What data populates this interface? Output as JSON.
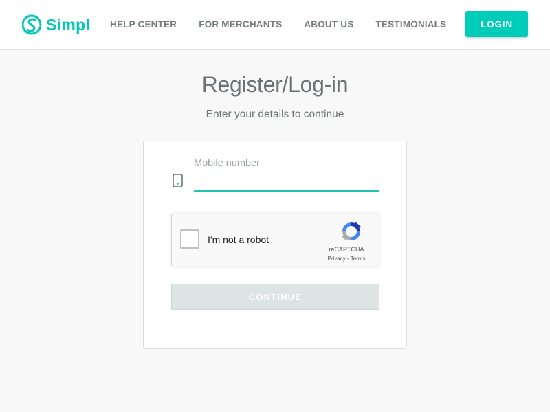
{
  "brand": {
    "name": "Simpl",
    "color": "#00c9b5",
    "icon": "simpl-logo-icon"
  },
  "nav": {
    "items": [
      {
        "label": "HELP CENTER"
      },
      {
        "label": "FOR MERCHANTS"
      },
      {
        "label": "ABOUT US"
      },
      {
        "label": "TESTIMONIALS"
      }
    ],
    "login_label": "LOGIN",
    "login_color": "#00cdb9"
  },
  "main": {
    "title": "Register/Log-in",
    "subtitle": "Enter your details to continue"
  },
  "form": {
    "mobile_icon": "phone-icon",
    "mobile_label": "Mobile number",
    "mobile_value": "",
    "accent_color": "#1fc4b3",
    "continue_label": "CONTINUE",
    "continue_state": "disabled"
  },
  "captcha": {
    "checkbox_label": "I'm not a robot",
    "checked": false,
    "brand": "reCAPTCHA",
    "privacy_label": "Privacy",
    "separator": " - ",
    "terms_label": "Terms",
    "icon": "recaptcha-logo-icon"
  }
}
